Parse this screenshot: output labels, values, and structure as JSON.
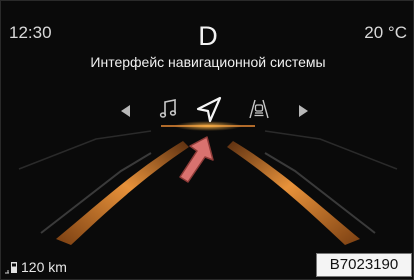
{
  "status_bar": {
    "time": "12:30",
    "gear": "D",
    "temperature": "20 °C"
  },
  "menu": {
    "title": "Интерфейс навигационной системы",
    "items": [
      {
        "name": "music-icon",
        "selected": false
      },
      {
        "name": "navigation-icon",
        "selected": true
      },
      {
        "name": "driver-assist-icon",
        "selected": false
      }
    ],
    "accent_color": "#e8923a"
  },
  "footer": {
    "range": "120 km",
    "image_code": "B7023190"
  },
  "colors": {
    "background": "#0a0a0a",
    "road_lines": "#e8923a",
    "pointer_arrow": "#d9726f"
  }
}
